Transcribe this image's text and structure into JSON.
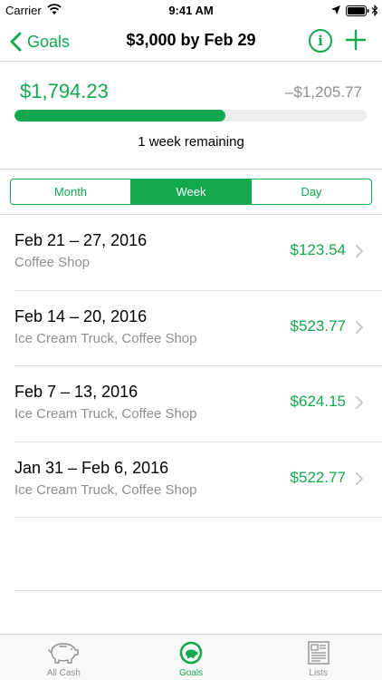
{
  "status_bar": {
    "carrier": "Carrier",
    "time": "9:41 AM"
  },
  "nav": {
    "back_label": "Goals",
    "title": "$3,000 by Feb 29",
    "info_glyph": "i"
  },
  "summary": {
    "saved": "$1,794.23",
    "remaining": "–$1,205.77",
    "progress_fraction": 0.6,
    "time_remaining": "1 week remaining"
  },
  "segments": [
    {
      "label": "Month",
      "active": false
    },
    {
      "label": "Week",
      "active": true
    },
    {
      "label": "Day",
      "active": false
    }
  ],
  "weeks": [
    {
      "title": "Feb 21 – 27, 2016",
      "subtitle": "Coffee Shop",
      "amount": "$123.54"
    },
    {
      "title": "Feb 14 – 20, 2016",
      "subtitle": "Ice Cream Truck, Coffee Shop",
      "amount": "$523.77"
    },
    {
      "title": "Feb 7 – 13, 2016",
      "subtitle": "Ice Cream Truck, Coffee Shop",
      "amount": "$624.15"
    },
    {
      "title": "Jan 31 – Feb 6, 2016",
      "subtitle": "Ice Cream Truck, Coffee Shop",
      "amount": "$522.77"
    }
  ],
  "tabs": [
    {
      "label": "All Cash",
      "icon": "piggy-bank-icon",
      "active": false
    },
    {
      "label": "Goals",
      "icon": "goal-icon",
      "active": true
    },
    {
      "label": "Lists",
      "icon": "list-document-icon",
      "active": false
    }
  ],
  "colors": {
    "accent": "#12a84e",
    "secondary_text": "#8e8e93",
    "progress_track": "#ececef"
  }
}
